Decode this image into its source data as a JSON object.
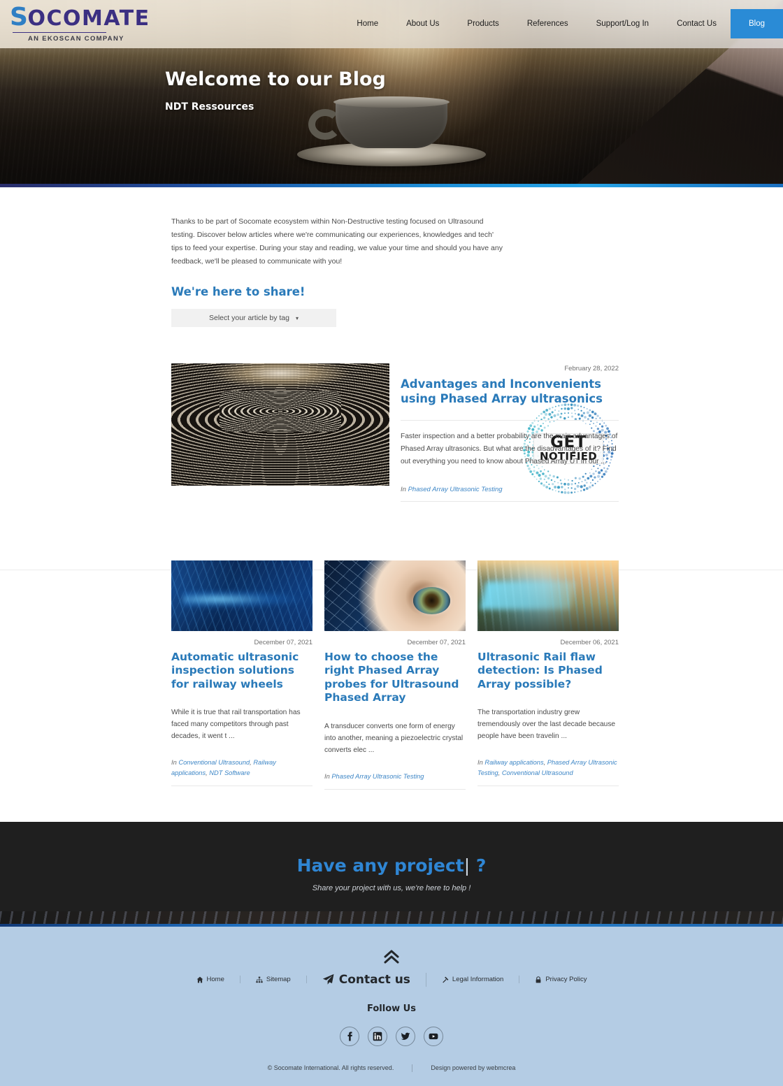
{
  "header": {
    "logo_main": "SOCOMATE",
    "logo_initial": "S",
    "logo_rest": "OCOMATE",
    "logo_sub": "AN EKOSCAN COMPANY",
    "accent_color": "#2a8bd6",
    "nav": [
      {
        "label": "Home",
        "active": false
      },
      {
        "label": "About Us",
        "active": false
      },
      {
        "label": "Products",
        "active": false
      },
      {
        "label": "References",
        "active": false
      },
      {
        "label": "Support/Log In",
        "active": false
      },
      {
        "label": "Contact Us",
        "active": false
      },
      {
        "label": "Blog",
        "active": true
      }
    ]
  },
  "hero": {
    "title": "Welcome to our Blog",
    "subtitle": "NDT Ressources"
  },
  "intro": {
    "paragraph": "Thanks to be part of Socomate ecosystem within Non-Destructive testing focused on Ultrasound testing. Discover below articles where we're communicating our experiences, knowledges and tech' tips to feed your expertise. During your stay and reading, we value your time and should you have any feedback, we'll be pleased to communicate with you!",
    "heading": "We're here to share!",
    "tag_select_label": "Select your article by tag",
    "tag_select_caret": "▾"
  },
  "badge": {
    "line1": "GET",
    "line2": "NOTIFIED",
    "ring_color_start": "#3fb8c8",
    "ring_color_end": "#2b6fb8"
  },
  "featured": {
    "date": "February 28, 2022",
    "title": "Advantages and Inconvenients using Phased Array ultrasonics",
    "excerpt": "Faster inspection and a better probability are the main advantages of Phased Array ultrasonics. But what are the disadvantages of it? Find out everything you need to know about Phased Array UT in our ...",
    "tag_prefix": "In",
    "tags": [
      "Phased Array Ultrasonic Testing"
    ],
    "image_name": "ultrasonic-wave-ripple-image"
  },
  "cards": [
    {
      "date": "December 07, 2021",
      "title": "Automatic ultrasonic inspection solutions for railway wheels",
      "excerpt": "While it is true that rail transportation has faced many competitors through past decades, it went t ...",
      "tag_prefix": "In",
      "tags": [
        "Conventional Ultrasound",
        "Railway applications",
        "NDT Software"
      ],
      "image_name": "railway-station-blue-scan-image"
    },
    {
      "date": "December 07, 2021",
      "title": "How to choose the right Phased Array probes for Ultrasound Phased Array",
      "excerpt": "A transducer converts one form of energy into another, meaning a piezoelectric crystal converts elec ...",
      "tag_prefix": "In",
      "tags": [
        "Phased Array Ultrasonic Testing"
      ],
      "image_name": "eye-network-overlay-image"
    },
    {
      "date": "December 06, 2021",
      "title": "Ultrasonic Rail flaw detection: Is Phased Array possible?",
      "excerpt": "The transportation industry grew tremendously over the last decade because people have been travelin ...",
      "tag_prefix": "In",
      "tags": [
        "Railway applications",
        "Phased Array Ultrasonic Testing",
        "Conventional Ultrasound"
      ],
      "image_name": "train-light-trail-railway-image"
    }
  ],
  "cta": {
    "title": "Have any project",
    "cursor": "|",
    "question": " ?",
    "subtitle": "Share your project with us, we're here to help !",
    "title_color": "#2f86d4"
  },
  "footer": {
    "background_color": "#b4cce4",
    "scroll_top_label": "scroll-to-top",
    "links": [
      {
        "label": "Home",
        "icon": "home-icon",
        "big": false
      },
      {
        "label": "Sitemap",
        "icon": "sitemap-icon",
        "big": false
      },
      {
        "label": "Contact us",
        "icon": "paper-plane-icon",
        "big": true
      },
      {
        "label": "Legal Information",
        "icon": "gavel-icon",
        "big": false
      },
      {
        "label": "Privacy Policy",
        "icon": "lock-icon",
        "big": false
      }
    ],
    "follow_heading": "Follow Us",
    "socials": [
      {
        "name": "facebook-icon",
        "glyph": "f"
      },
      {
        "name": "linkedin-icon",
        "glyph": "in"
      },
      {
        "name": "twitter-icon",
        "glyph": "t"
      },
      {
        "name": "youtube-icon",
        "glyph": "yt"
      }
    ],
    "copyright": "© Socomate International. All rights reserved.",
    "credit": "Design powered by webmcrea"
  }
}
